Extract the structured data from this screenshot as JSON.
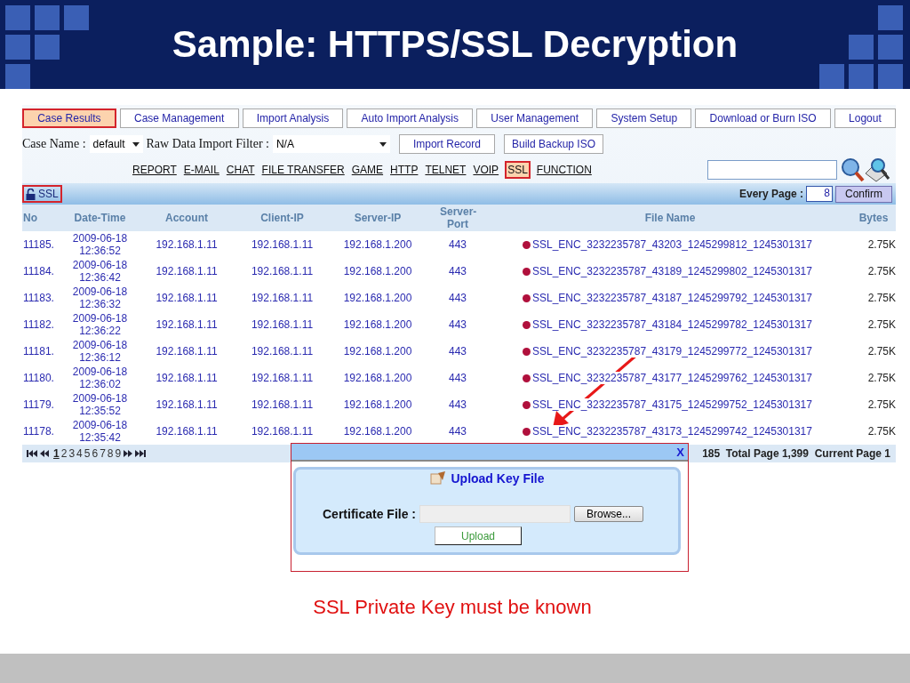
{
  "slide": {
    "title": "Sample: HTTPS/SSL Decryption",
    "caption": "SSL Private Key must be known"
  },
  "menu": [
    {
      "label": "Case Results",
      "selected": true
    },
    {
      "label": "Case Management",
      "selected": false
    },
    {
      "label": "Import Analysis",
      "selected": false
    },
    {
      "label": "Auto Import Analysis",
      "selected": false
    },
    {
      "label": "User Management",
      "selected": false
    },
    {
      "label": "System Setup",
      "selected": false
    },
    {
      "label": "Download or Burn ISO",
      "selected": false
    },
    {
      "label": "Logout",
      "selected": false
    }
  ],
  "filters": {
    "case_name_label": "Case Name :",
    "case_name": "default",
    "filter_label": "Raw Data Import Filter :",
    "filter": "N/A",
    "buttons": [
      "Import Record",
      "Build Backup ISO"
    ]
  },
  "categories": [
    {
      "label": "REPORT",
      "selected": false
    },
    {
      "label": "E-MAIL",
      "selected": false
    },
    {
      "label": "CHAT",
      "selected": false
    },
    {
      "label": "FILE TRANSFER",
      "selected": false
    },
    {
      "label": "GAME",
      "selected": false
    },
    {
      "label": "HTTP",
      "selected": false
    },
    {
      "label": "TELNET",
      "selected": false
    },
    {
      "label": "VOIP",
      "selected": false
    },
    {
      "label": "SSL",
      "selected": true
    },
    {
      "label": "FUNCTION",
      "selected": false
    }
  ],
  "section": {
    "label": "SSL",
    "every_page_label": "Every Page :",
    "every_page": "8",
    "confirm": "Confirm"
  },
  "table": {
    "columns": [
      "No",
      "Date-Time",
      "Account",
      "Client-IP",
      "Server-IP",
      "Server-Port",
      "File Name",
      "Bytes"
    ],
    "rows": [
      [
        "11185.",
        "2009-06-18 12:36:52",
        "192.168.1.11",
        "192.168.1.11",
        "192.168.1.200",
        "443",
        "SSL_ENC_3232235787_43203_1245299812_1245301317",
        "2.75K"
      ],
      [
        "11184.",
        "2009-06-18 12:36:42",
        "192.168.1.11",
        "192.168.1.11",
        "192.168.1.200",
        "443",
        "SSL_ENC_3232235787_43189_1245299802_1245301317",
        "2.75K"
      ],
      [
        "11183.",
        "2009-06-18 12:36:32",
        "192.168.1.11",
        "192.168.1.11",
        "192.168.1.200",
        "443",
        "SSL_ENC_3232235787_43187_1245299792_1245301317",
        "2.75K"
      ],
      [
        "11182.",
        "2009-06-18 12:36:22",
        "192.168.1.11",
        "192.168.1.11",
        "192.168.1.200",
        "443",
        "SSL_ENC_3232235787_43184_1245299782_1245301317",
        "2.75K"
      ],
      [
        "11181.",
        "2009-06-18 12:36:12",
        "192.168.1.11",
        "192.168.1.11",
        "192.168.1.200",
        "443",
        "SSL_ENC_3232235787_43179_1245299772_1245301317",
        "2.75K"
      ],
      [
        "11180.",
        "2009-06-18 12:36:02",
        "192.168.1.11",
        "192.168.1.11",
        "192.168.1.200",
        "443",
        "SSL_ENC_3232235787_43177_1245299762_1245301317",
        "2.75K"
      ],
      [
        "11179.",
        "2009-06-18 12:35:52",
        "192.168.1.11",
        "192.168.1.11",
        "192.168.1.200",
        "443",
        "SSL_ENC_3232235787_43175_1245299752_1245301317",
        "2.75K"
      ],
      [
        "11178.",
        "2009-06-18 12:35:42",
        "192.168.1.11",
        "192.168.1.11",
        "192.168.1.200",
        "443",
        "SSL_ENC_3232235787_43173_1245299742_1245301317",
        "2.75K"
      ]
    ]
  },
  "pager": {
    "pages": [
      {
        "label": "1",
        "selected": true
      },
      {
        "label": "2",
        "selected": false
      },
      {
        "label": "3",
        "selected": false
      },
      {
        "label": "4",
        "selected": false
      },
      {
        "label": "5",
        "selected": false
      },
      {
        "label": "6",
        "selected": false
      },
      {
        "label": "7",
        "selected": false
      },
      {
        "label": "8",
        "selected": false
      },
      {
        "label": "9",
        "selected": false
      }
    ],
    "summary": "185  Total Page 1,399  Current Page 1"
  },
  "dialog": {
    "close": "X",
    "title": "Upload Key File",
    "field_label": "Certificate File :",
    "browse": "Browse...",
    "upload": "Upload"
  }
}
